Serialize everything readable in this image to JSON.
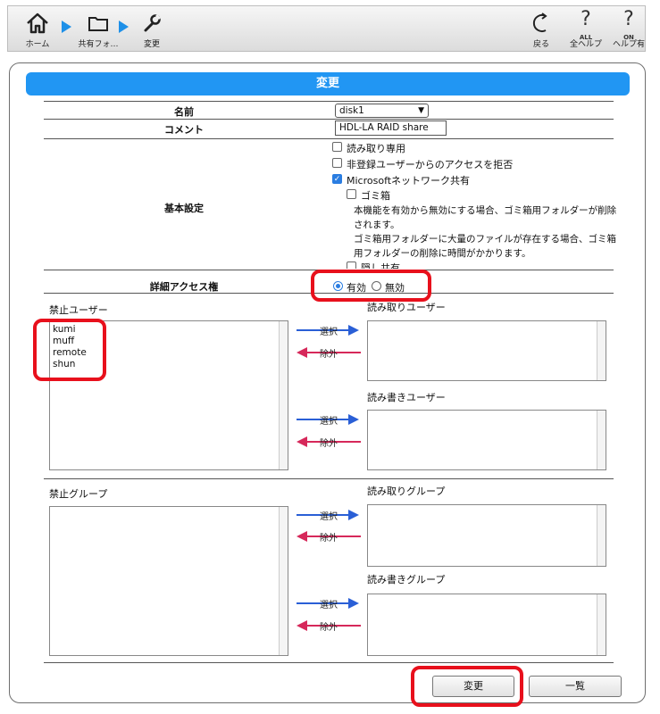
{
  "toolbar": {
    "home_label": "ホーム",
    "share_label": "共有フォ…",
    "edit_label": "変更",
    "back_label": "戻る",
    "all_help_label": "全ヘルプ",
    "help_on_label": "ヘルプ有",
    "all_help_sub": "ALL",
    "help_on_sub": "ON",
    "help_glyph": "?"
  },
  "title": "変更",
  "form": {
    "name_label": "名前",
    "name_value": "disk1",
    "comment_label": "コメント",
    "comment_value": "HDL-LA RAID share",
    "basic_label": "基本設定",
    "options": {
      "readonly": "読み取り専用",
      "deny_unregistered": "非登録ユーザーからのアクセスを拒否",
      "ms_network": "Microsoftネットワーク共有",
      "trash": "ゴミ箱",
      "trash_note1": "本機能を有効から無効にする場合、ゴミ箱用フォルダーが削除されます。",
      "trash_note2": "ゴミ箱用フォルダーに大量のファイルが存在する場合、ゴミ箱用フォルダーの削除に時間がかかります。",
      "hidden_share": "隠し共有"
    },
    "detail_label": "詳細アクセス権",
    "detail_on": "有効",
    "detail_off": "無効"
  },
  "users": {
    "deny_title": "禁止ユーザー",
    "deny_items": [
      "kumi",
      "muff",
      "remote",
      "shun"
    ],
    "read_title": "読み取りユーザー",
    "rw_title": "読み書きユーザー"
  },
  "groups": {
    "deny_title": "禁止グループ",
    "read_title": "読み取りグループ",
    "rw_title": "読み書きグループ"
  },
  "arrows": {
    "select": "選択",
    "remove": "除外"
  },
  "buttons": {
    "apply": "変更",
    "list": "一覧"
  },
  "colors": {
    "accent": "#2196f3",
    "highlight": "#e8101c",
    "select_arrow": "#2a5fd6",
    "remove_arrow": "#d6285a"
  }
}
